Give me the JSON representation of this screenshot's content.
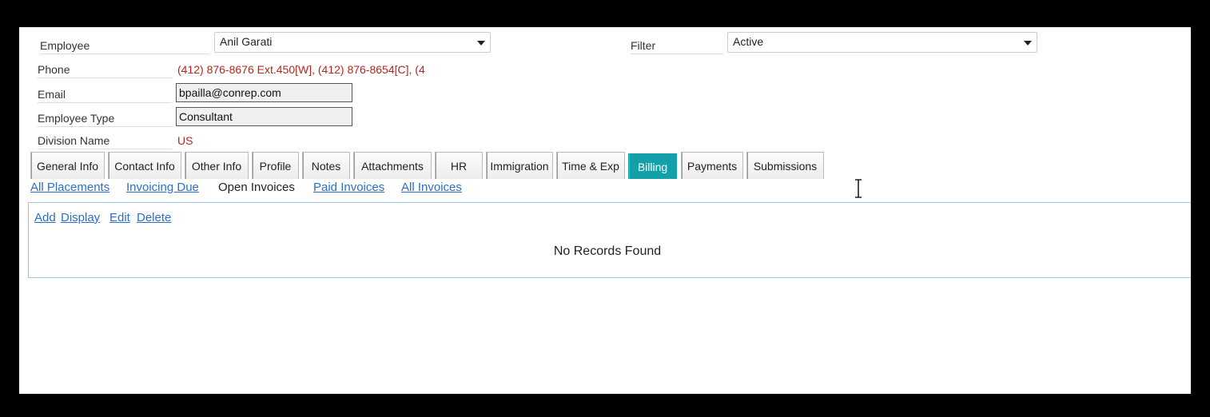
{
  "form": {
    "employee_label": "Employee",
    "employee_value": "Anil  Garati",
    "filter_label": "Filter",
    "filter_value": "Active",
    "phone_label": "Phone",
    "phone_value": "(412) 876-8676 Ext.450[W], (412) 876-8654[C], (4",
    "email_label": "Email",
    "email_value": "bpailla@conrep.com",
    "employee_type_label": "Employee Type",
    "employee_type_value": "Consultant",
    "division_label": "Division Name",
    "division_value": "US"
  },
  "tabs": [
    {
      "label": "General Info"
    },
    {
      "label": "Contact Info"
    },
    {
      "label": "Other Info"
    },
    {
      "label": "Profile"
    },
    {
      "label": "Notes"
    },
    {
      "label": "Attachments"
    },
    {
      "label": "HR"
    },
    {
      "label": "Immigration"
    },
    {
      "label": "Time & Exp"
    },
    {
      "label": "Billing",
      "active": true
    },
    {
      "label": "Payments"
    },
    {
      "label": "Submissions"
    }
  ],
  "subnav": {
    "all_placements": "All Placements",
    "invoicing_due": "Invoicing Due",
    "open_invoices": "Open Invoices",
    "paid_invoices": "Paid Invoices",
    "all_invoices": "All Invoices"
  },
  "actions": {
    "add": "Add",
    "display": "Display",
    "edit": "Edit",
    "delete": "Delete"
  },
  "empty_message": "No Records Found",
  "colors": {
    "active_tab": "#14a0a8",
    "link": "#2a6fd0",
    "red_value": "#b3261e",
    "panel_border": "#9ec3e6"
  }
}
